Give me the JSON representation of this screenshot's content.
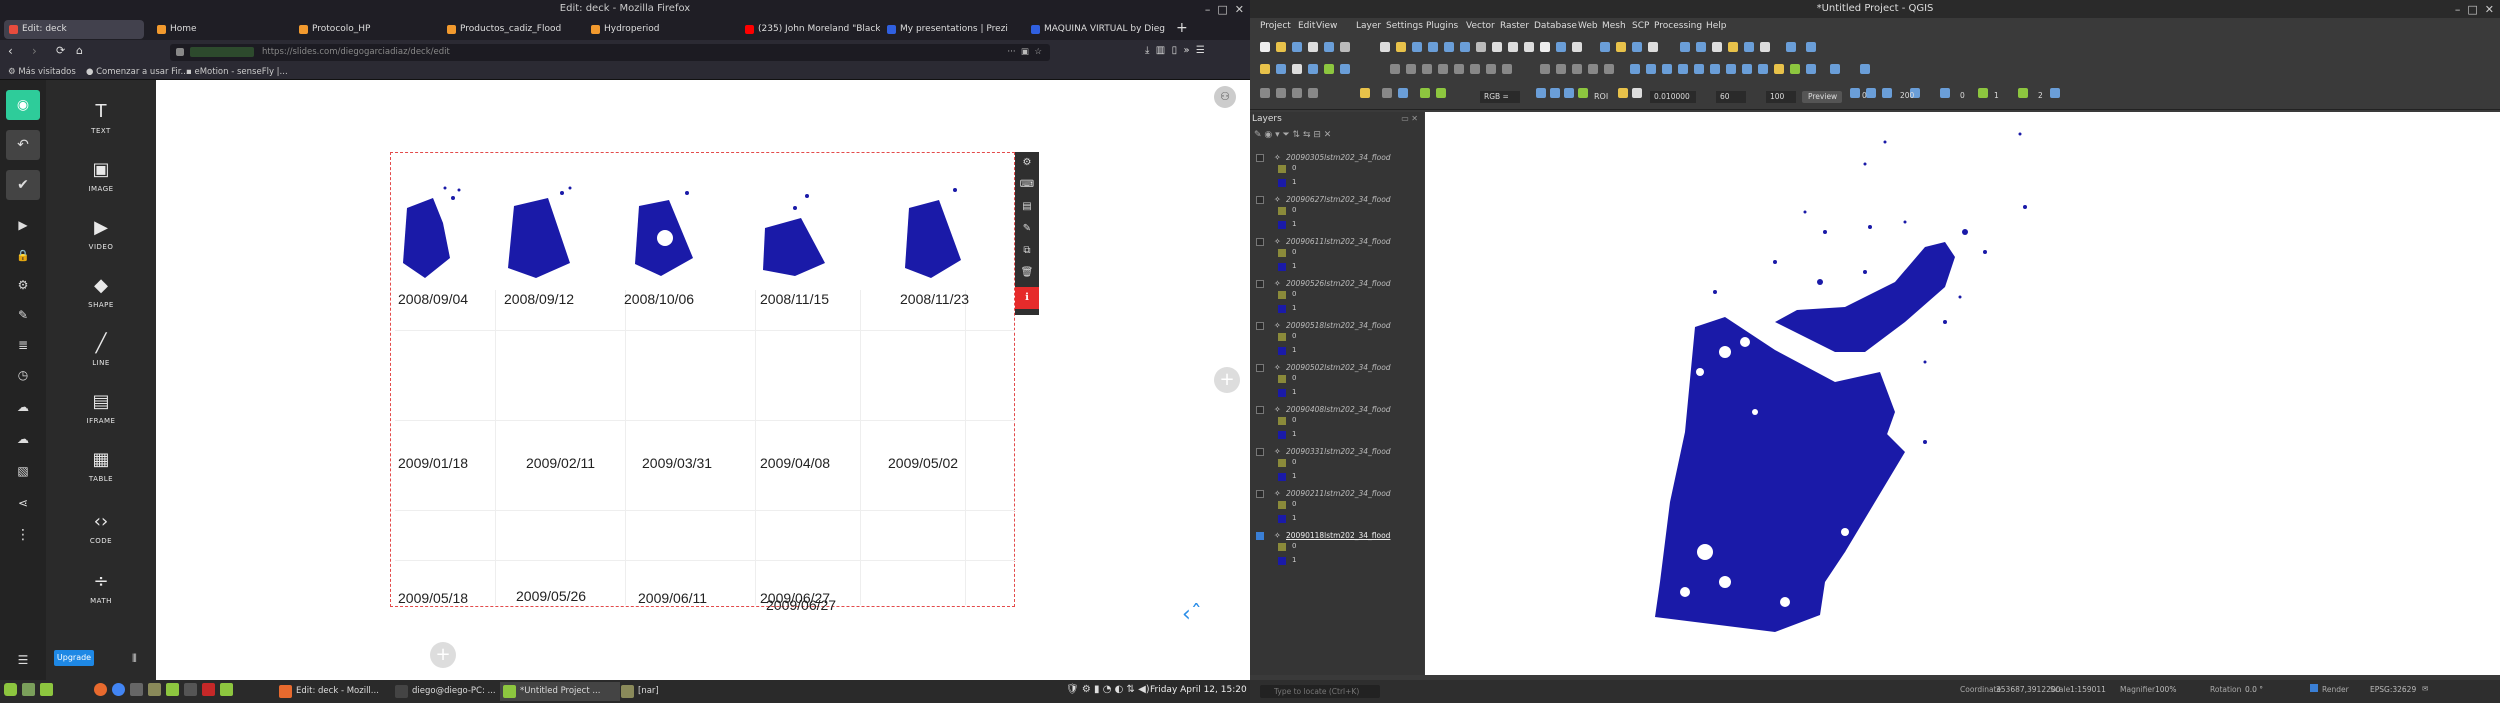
{
  "firefox": {
    "title": "Edit: deck - Mozilla Firefox",
    "tabs": [
      {
        "label": "Edit: deck",
        "color": "#e84c3d",
        "active": true
      },
      {
        "label": "Home",
        "color": "#f29a2e"
      },
      {
        "label": "Protocolo_HP",
        "color": "#f29a2e"
      },
      {
        "label": "Productos_cadiz_Flood",
        "color": "#f29a2e"
      },
      {
        "label": "Hydroperiod",
        "color": "#f29a2e"
      },
      {
        "label": "(235) John Moreland \"Black&",
        "color": "#ff0000"
      },
      {
        "label": "My presentations | Prezi",
        "color": "#3060e0"
      },
      {
        "label": "MAQUINA VIRTUAL by Dieg",
        "color": "#3060e0"
      }
    ],
    "url": "https://slides.com/diegogarciadiaz/deck/edit",
    "bookmarks": [
      "Más visitados",
      "Comenzar a usar Fir...",
      "eMotion - senseFly |..."
    ]
  },
  "slides": {
    "tools": [
      {
        "label": "TEXT",
        "icon": "T"
      },
      {
        "label": "IMAGE",
        "icon": "▣"
      },
      {
        "label": "VIDEO",
        "icon": "▶"
      },
      {
        "label": "SHAPE",
        "icon": "◆"
      },
      {
        "label": "LINE",
        "icon": "╱"
      },
      {
        "label": "IFRAME",
        "icon": "▤"
      },
      {
        "label": "TABLE",
        "icon": "▦"
      },
      {
        "label": "CODE",
        "icon": "‹›"
      },
      {
        "label": "MATH",
        "icon": "÷"
      }
    ],
    "upgrade_label": "Upgrade",
    "dates_row1": [
      "2008/09/04",
      "2008/09/12",
      "2008/10/06",
      "2008/11/15",
      "2008/11/23"
    ],
    "dates_row2": [
      "2009/01/18",
      "2009/02/11",
      "2009/03/31",
      "2009/04/08",
      "2009/05/02"
    ],
    "dates_row3": [
      "2009/05/18",
      "2009/05/26",
      "2009/06/11",
      "2009/06/27",
      "2009/06/27"
    ],
    "map_color": "#1a1aa8"
  },
  "qgis": {
    "title": "*Untitled Project - QGIS",
    "menu": [
      "Project",
      "Edit",
      "View",
      "Layer",
      "Settings",
      "Plugins",
      "Vector",
      "Raster",
      "Database",
      "Web",
      "Mesh",
      "SCP",
      "Processing",
      "Help"
    ],
    "toolbar_values": {
      "rgb": "RGB =",
      "roi_label": "ROI",
      "dist": "0.010000",
      "min": "60",
      "max": "100",
      "preview": "Preview",
      "v1": "0",
      "v2": "200",
      "v3": "0",
      "v4": "1",
      "v5": "2"
    },
    "layers_title": "Layers",
    "layers": [
      {
        "name": "20090305lstm202_34_flood",
        "checked": false
      },
      {
        "name": "20090627lstm202_34_flood",
        "checked": false
      },
      {
        "name": "20090611lstm202_34_flood",
        "checked": false
      },
      {
        "name": "20090526lstm202_34_flood",
        "checked": false
      },
      {
        "name": "20090518lstm202_34_flood",
        "checked": false
      },
      {
        "name": "20090502lstm202_34_flood",
        "checked": false
      },
      {
        "name": "20090408lstm202_34_flood",
        "checked": false
      },
      {
        "name": "20090331lstm202_34_flood",
        "checked": false
      },
      {
        "name": "20090211lstm202_34_flood",
        "checked": false
      },
      {
        "name": "20090118lstm202_34_flood",
        "checked": true
      }
    ],
    "class_values": [
      "0",
      "1"
    ],
    "search_placeholder": "Type to locate (Ctrl+K)",
    "status": {
      "coord_label": "Coordinate",
      "coord": "353687,3912200",
      "scale_label": "Scale",
      "scale": "1:159011",
      "magnifier_label": "Magnifier",
      "magnifier": "100%",
      "rotation_label": "Rotation",
      "rotation": "0.0 °",
      "render": "Render",
      "crs": "EPSG:32629"
    }
  },
  "taskbar": {
    "items": [
      {
        "label": "Edit: deck - Mozill...",
        "color": "#e86a2e"
      },
      {
        "label": "diego@diego-PC: ...",
        "color": "#444"
      },
      {
        "label": "*Untitled Project ...",
        "color": "#8dc63f"
      },
      {
        "label": "[nar]",
        "color": "#8a8a5a"
      }
    ],
    "clock": "Friday April 12, 15:20"
  }
}
